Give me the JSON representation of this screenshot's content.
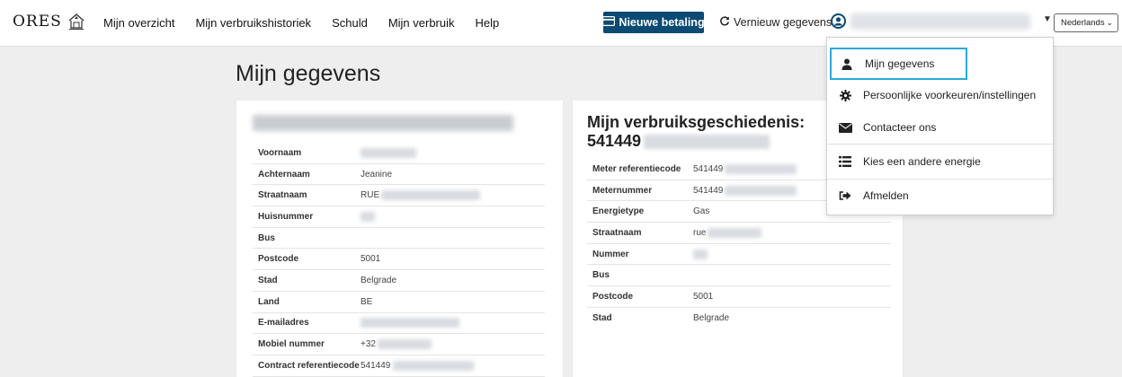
{
  "brand": {
    "logo_text": "ORES"
  },
  "nav": {
    "items": [
      {
        "label": "Mijn overzicht"
      },
      {
        "label": "Mijn verbruikshistoriek"
      },
      {
        "label": "Schuld"
      },
      {
        "label": "Mijn verbruik"
      },
      {
        "label": "Help"
      }
    ],
    "new_payment_label": "Nieuwe betaling",
    "refresh_label": "Vernieuw gegevens",
    "language": "Nederlands"
  },
  "page": {
    "title": "Mijn gegevens"
  },
  "personal_card": {
    "rows": [
      {
        "label": "Voornaam",
        "value": ""
      },
      {
        "label": "Achternaam",
        "value": "Jeanine"
      },
      {
        "label": "Straatnaam",
        "value": "RUE"
      },
      {
        "label": "Huisnummer",
        "value": ""
      },
      {
        "label": "Bus",
        "value": ""
      },
      {
        "label": "Postcode",
        "value": "5001"
      },
      {
        "label": "Stad",
        "value": "Belgrade"
      },
      {
        "label": "Land",
        "value": "BE"
      },
      {
        "label": "E-mailadres",
        "value": ""
      },
      {
        "label": "Mobiel nummer",
        "value": "+32"
      },
      {
        "label": "Contract referentiecode",
        "value": "541449"
      }
    ]
  },
  "consumption_card": {
    "title_line1": "Mijn verbruiksgeschiedenis:",
    "title_line2": "541449",
    "rows": [
      {
        "label": "Meter referentiecode",
        "value": "541449"
      },
      {
        "label": "Meternummer",
        "value": "541449"
      },
      {
        "label": "Energietype",
        "value": "Gas"
      },
      {
        "label": "Straatnaam",
        "value": "rue"
      },
      {
        "label": "Nummer",
        "value": ""
      },
      {
        "label": "Bus",
        "value": ""
      },
      {
        "label": "Postcode",
        "value": "5001"
      },
      {
        "label": "Stad",
        "value": "Belgrade"
      }
    ]
  },
  "user_menu": {
    "items": [
      {
        "label": "Mijn gegevens",
        "icon": "user-icon"
      },
      {
        "label": "Persoonlijke voorkeuren/instellingen",
        "icon": "gear-icon"
      },
      {
        "label": "Contacteer ons",
        "icon": "envelope-icon"
      },
      {
        "label": "Kies een andere energie",
        "icon": "list-icon"
      },
      {
        "label": "Afmelden",
        "icon": "sign-out-icon"
      }
    ]
  },
  "colors": {
    "primary_button": "#0b4a73",
    "focus_outline": "#29a9d9",
    "background": "#eeeeee"
  }
}
